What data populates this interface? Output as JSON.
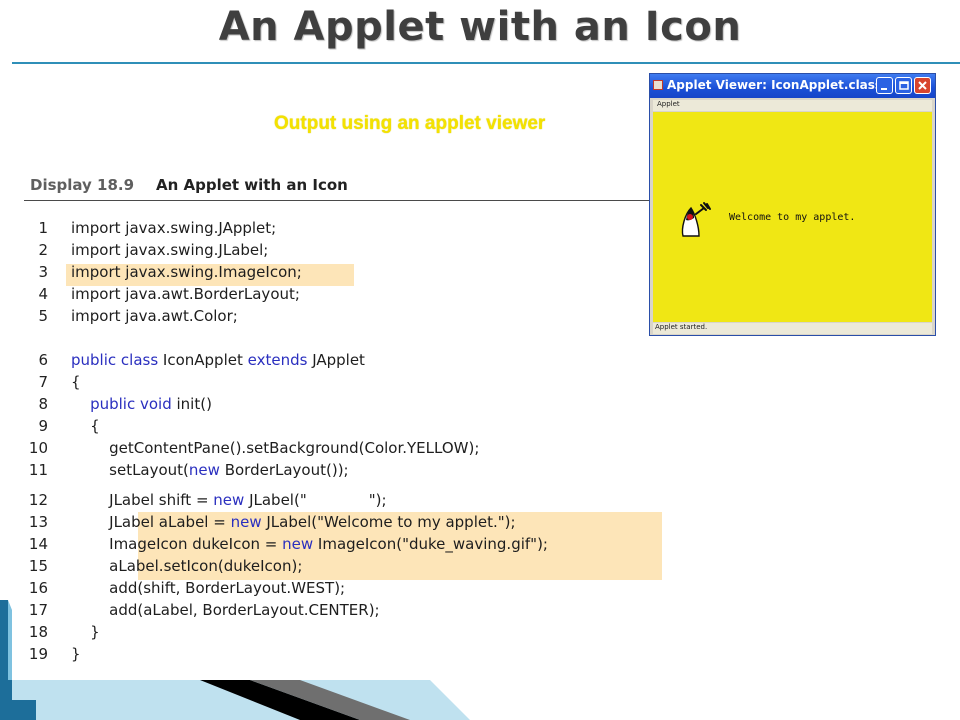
{
  "slide": {
    "title": "An Applet with an Icon",
    "output_caption": "Output using an applet viewer"
  },
  "display": {
    "number": "Display 18.9",
    "title": "An Applet with an Icon"
  },
  "code_lines": [
    {
      "n": "1",
      "parts": [
        [
          "kw",
          ""
        ],
        [
          "txt",
          "import javax.swing.JApplet;"
        ]
      ]
    },
    {
      "n": "2",
      "parts": [
        [
          "txt",
          "import javax.swing.JLabel;"
        ]
      ]
    },
    {
      "n": "3",
      "parts": [
        [
          "txt",
          "import javax.swing.ImageIcon;"
        ]
      ]
    },
    {
      "n": "4",
      "parts": [
        [
          "txt",
          "import java.awt.BorderLayout;"
        ]
      ]
    },
    {
      "n": "5",
      "parts": [
        [
          "txt",
          "import java.awt.Color;"
        ]
      ]
    },
    {
      "n": "6",
      "parts": [
        [
          "kw",
          "public class"
        ],
        [
          "txt",
          " IconApplet "
        ],
        [
          "kw",
          "extends"
        ],
        [
          "txt",
          " JApplet"
        ]
      ]
    },
    {
      "n": "7",
      "parts": [
        [
          "txt",
          "{"
        ]
      ]
    },
    {
      "n": "8",
      "parts": [
        [
          "txt",
          "    "
        ],
        [
          "kw",
          "public void"
        ],
        [
          "txt",
          " init()"
        ]
      ]
    },
    {
      "n": "9",
      "parts": [
        [
          "txt",
          "    {"
        ]
      ]
    },
    {
      "n": "10",
      "parts": [
        [
          "txt",
          "        getContentPane().setBackground(Color.YELLOW);"
        ]
      ]
    },
    {
      "n": "11",
      "parts": [
        [
          "txt",
          "        setLayout("
        ],
        [
          "kw",
          "new"
        ],
        [
          "txt",
          " BorderLayout());"
        ]
      ]
    },
    {
      "n": "12",
      "parts": [
        [
          "txt",
          "        JLabel shift = "
        ],
        [
          "kw",
          "new"
        ],
        [
          "txt",
          " JLabel(\"             \");"
        ]
      ]
    },
    {
      "n": "13",
      "parts": [
        [
          "txt",
          "        JLabel aLabel = "
        ],
        [
          "kw",
          "new"
        ],
        [
          "txt",
          " JLabel(\"Welcome to my applet.\");"
        ]
      ]
    },
    {
      "n": "14",
      "parts": [
        [
          "txt",
          "        ImageIcon dukeIcon = "
        ],
        [
          "kw",
          "new"
        ],
        [
          "txt",
          " ImageIcon(\"duke_waving.gif\");"
        ]
      ]
    },
    {
      "n": "15",
      "parts": [
        [
          "txt",
          "        aLabel.setIcon(dukeIcon);"
        ]
      ]
    },
    {
      "n": "16",
      "parts": [
        [
          "txt",
          "        add(shift, BorderLayout.WEST);"
        ]
      ]
    },
    {
      "n": "17",
      "parts": [
        [
          "txt",
          "        add(aLabel, BorderLayout.CENTER);"
        ]
      ]
    },
    {
      "n": "18",
      "parts": [
        [
          "txt",
          "    }"
        ]
      ]
    },
    {
      "n": "19",
      "parts": [
        [
          "txt",
          "}"
        ]
      ]
    }
  ],
  "applet_viewer": {
    "window_title": "Applet Viewer: IconApplet.class",
    "menu_label": "Applet",
    "label_text": "Welcome to my applet.",
    "status": "Applet started.",
    "icon": "duke-waving-icon",
    "background_color": "#f0e714"
  },
  "colors": {
    "title_rule": "#2f8fb8",
    "highlight": "#fde5b8",
    "keyword": "#2a2fbf",
    "caption": "#f4e200"
  }
}
